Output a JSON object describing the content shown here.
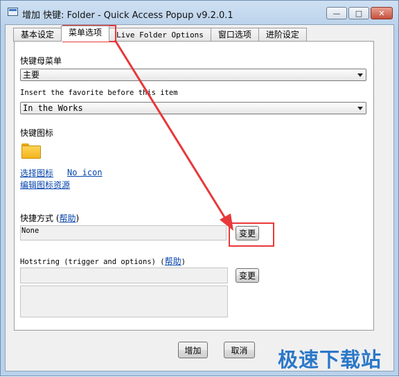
{
  "window": {
    "title": "增加 快键: Folder - Quick Access Popup v9.2.0.1",
    "controls": {
      "minimize": "—",
      "maximize": "□",
      "close": "✕"
    }
  },
  "tabs": [
    {
      "label": "基本设定"
    },
    {
      "label": "菜单选项",
      "active": true
    },
    {
      "label": "Live Folder Options"
    },
    {
      "label": "窗口选项"
    },
    {
      "label": "进阶设定"
    }
  ],
  "form": {
    "parent_menu_label": "快键母菜单",
    "parent_menu_value": "主要",
    "insert_before_label": "Insert the favorite before this item",
    "insert_before_value": "In the Works",
    "icon_label": "快键图标",
    "icon_links": {
      "select": "选择图标",
      "no_icon": "No icon",
      "edit_resource": "编辑图标资源"
    },
    "shortcut_label": "快捷方式 (",
    "shortcut_help": "帮助",
    "shortcut_close": ")",
    "shortcut_value": "None",
    "shortcut_change": "变更",
    "hotstring_label": "Hotstring (trigger and options) (",
    "hotstring_help": "帮助",
    "hotstring_close": ")",
    "hotstring_change": "变更"
  },
  "buttons": {
    "add": "增加",
    "cancel": "取消"
  },
  "watermark": "极速下载站",
  "colors": {
    "annotation_red": "#e8383a",
    "link_blue": "#0645ad",
    "watermark_blue": "#2b78c8"
  },
  "icons": {
    "app": "app-window-icon",
    "favorite": "folder-icon"
  }
}
